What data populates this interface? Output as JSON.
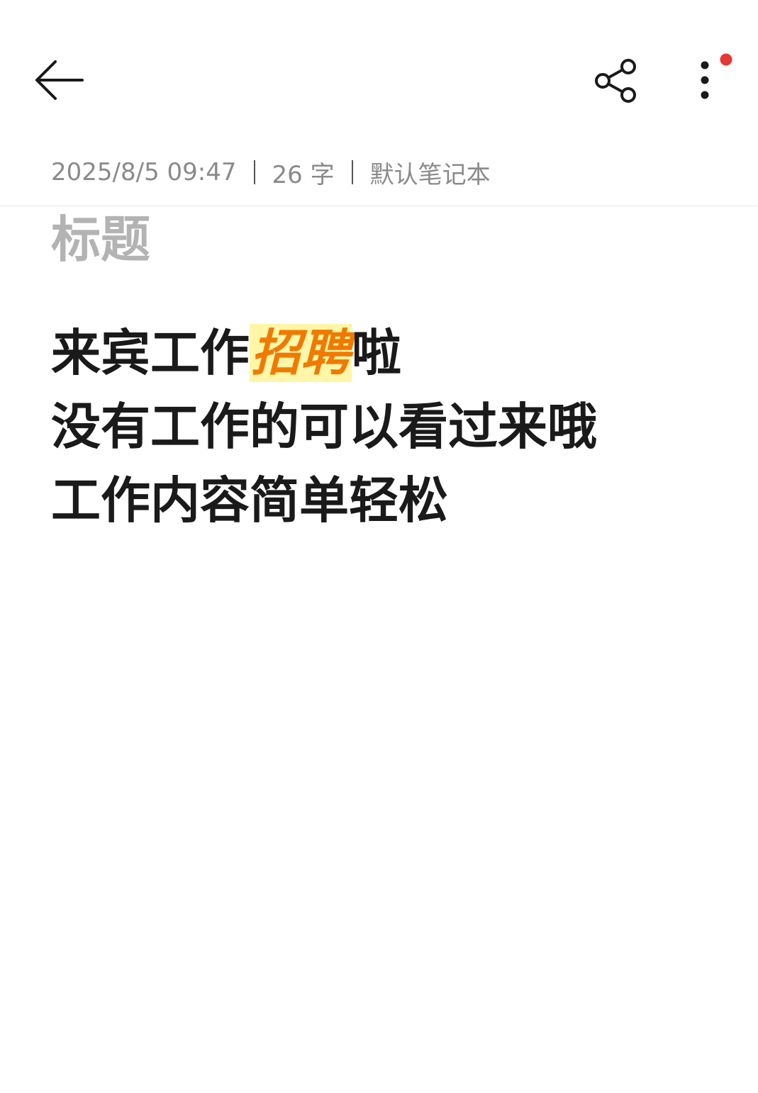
{
  "header": {
    "back_icon": "arrow-left-icon",
    "share_icon": "share-icon",
    "more_icon": "more-vertical-icon",
    "notification_dot_color": "#e53935"
  },
  "meta": {
    "datetime": "2025/8/5 09:47",
    "word_count": "26 字",
    "notebook": "默认笔记本"
  },
  "note": {
    "title_placeholder": "标题",
    "lines": [
      {
        "before": "来宾工作",
        "highlight": "招聘",
        "after": "啦"
      },
      "没有工作的可以看过来哦",
      "工作内容简单轻松"
    ],
    "highlight_text_color": "#f07a00",
    "highlight_bg_color": "#fff6a8"
  }
}
